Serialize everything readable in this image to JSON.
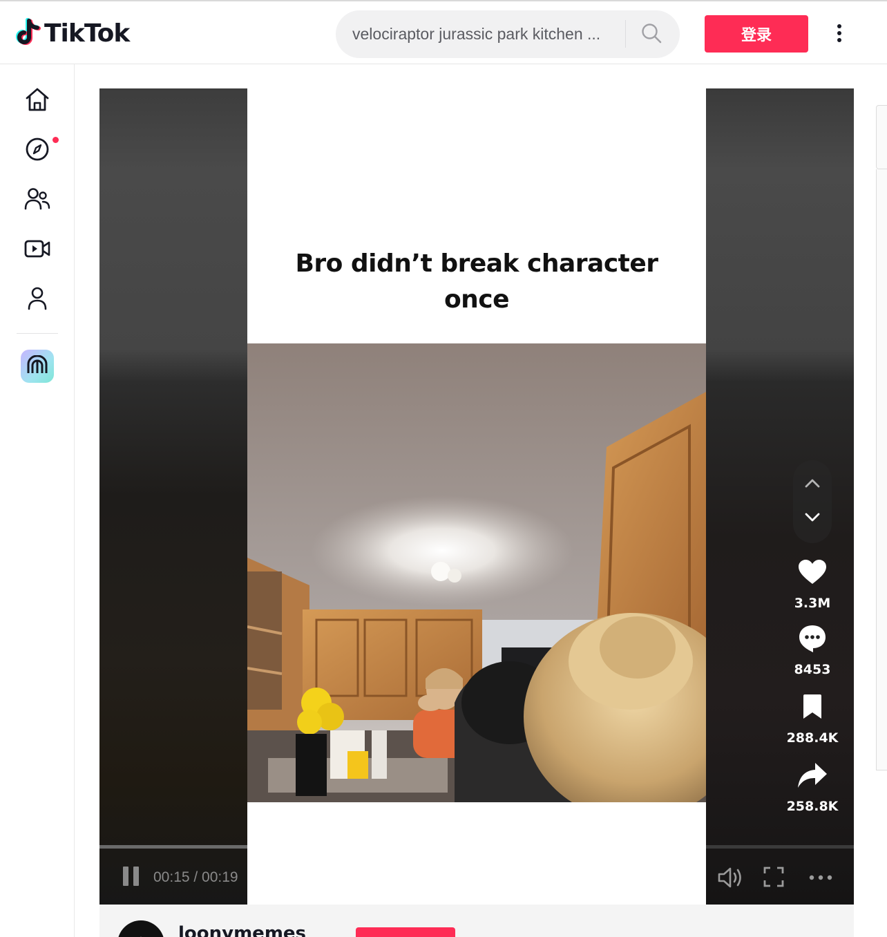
{
  "header": {
    "logo_text": "TikTok",
    "search": {
      "value": "velociraptor jurassic park kitchen ..."
    },
    "login_label": "登录"
  },
  "sidebar": {
    "items": [
      {
        "name": "home",
        "icon": "home-icon"
      },
      {
        "name": "explore",
        "icon": "compass-icon",
        "has_notification_dot": true
      },
      {
        "name": "following",
        "icon": "people-icon"
      },
      {
        "name": "live",
        "icon": "live-video-icon"
      },
      {
        "name": "profile",
        "icon": "person-icon"
      }
    ],
    "badge_icon": "tiktok-live-arch-icon"
  },
  "video": {
    "caption_line1": "Bro didn’t break character",
    "caption_line2": "once",
    "time": "00:15 / 00:19",
    "progress_fraction": 0.79,
    "playing": true
  },
  "actions": {
    "likes": "3.3M",
    "comments": "8453",
    "saves": "288.4K",
    "shares": "258.8K"
  },
  "author": {
    "username": "loonymemes"
  },
  "colors": {
    "brand_red": "#fe2c55",
    "text_dark": "#161823",
    "search_bg": "#f1f1f2"
  }
}
